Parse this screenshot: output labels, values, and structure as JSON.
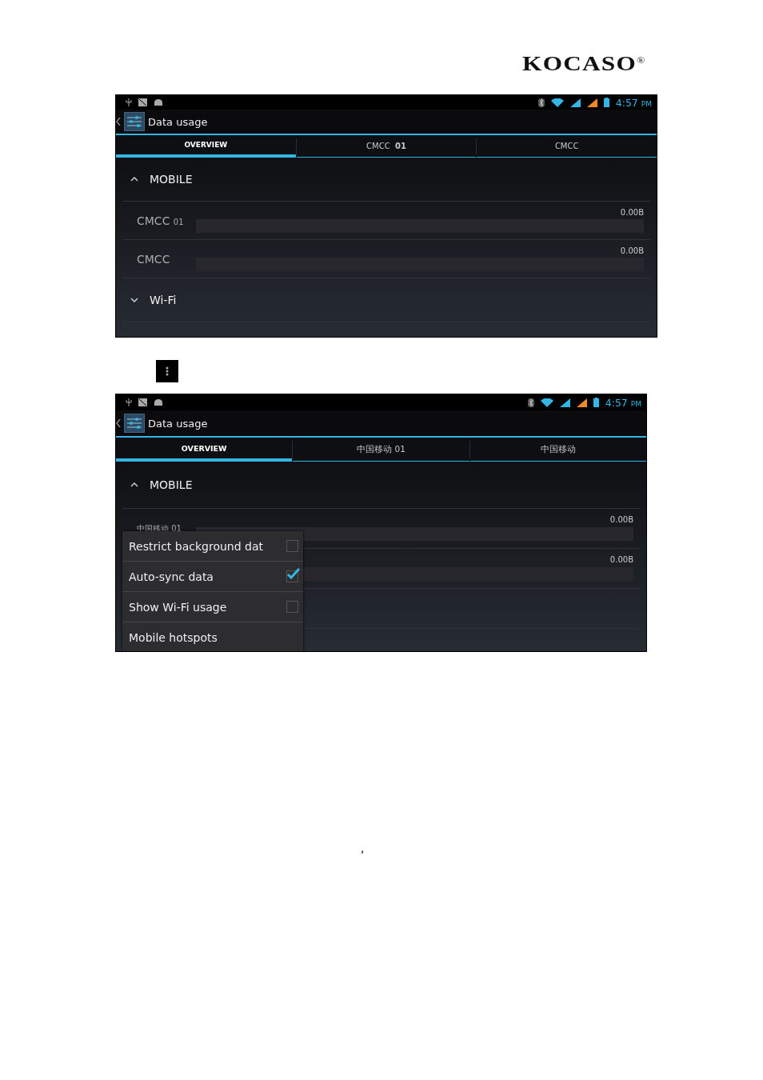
{
  "logo": {
    "text": "KOCASO$^{®}$"
  },
  "screens": [
    {
      "status": {
        "time": "4:57",
        "ampm": "PM"
      },
      "title": "Data usage",
      "tabs": [
        {
          "label": "OVERVIEW",
          "selected": true
        },
        {
          "label": "CMCC  **01**",
          "selected": false
        },
        {
          "label": "CMCC",
          "selected": false
        }
      ],
      "sections": [
        {
          "kind": "group",
          "title": "MOBILE",
          "expanded": true,
          "items": [
            {
              "name": "CMCC",
              "suffix": "01",
              "usage": "0.00B"
            },
            {
              "name": "CMCC",
              "usage": "0.00B"
            }
          ]
        },
        {
          "kind": "group",
          "title": "Wi-Fi",
          "expanded": false
        }
      ]
    },
    {
      "status": {
        "time": "4:57",
        "ampm": "PM"
      },
      "title": "Data usage",
      "tabs": [
        {
          "label": "OVERVIEW",
          "selected": true
        },
        {
          "label": "中国移动 01",
          "selected": false
        },
        {
          "label": "中国移动",
          "selected": false
        }
      ],
      "sections": [
        {
          "kind": "group",
          "title": "MOBILE",
          "expanded": true,
          "items": [
            {
              "name": "中国移动 01",
              "usage": "0.00B"
            },
            {
              "usage": "0.00B"
            }
          ]
        },
        {
          "kind": "covered"
        }
      ],
      "menu": [
        {
          "label": "Restrict background dat",
          "kind": "check",
          "checked": false
        },
        {
          "label": "Auto-sync data",
          "kind": "check",
          "checked": true
        },
        {
          "label": "Show Wi-Fi usage",
          "kind": "check",
          "checked": false
        },
        {
          "label": "Mobile hotspots",
          "kind": "plain"
        }
      ]
    }
  ],
  "footnote": ","
}
